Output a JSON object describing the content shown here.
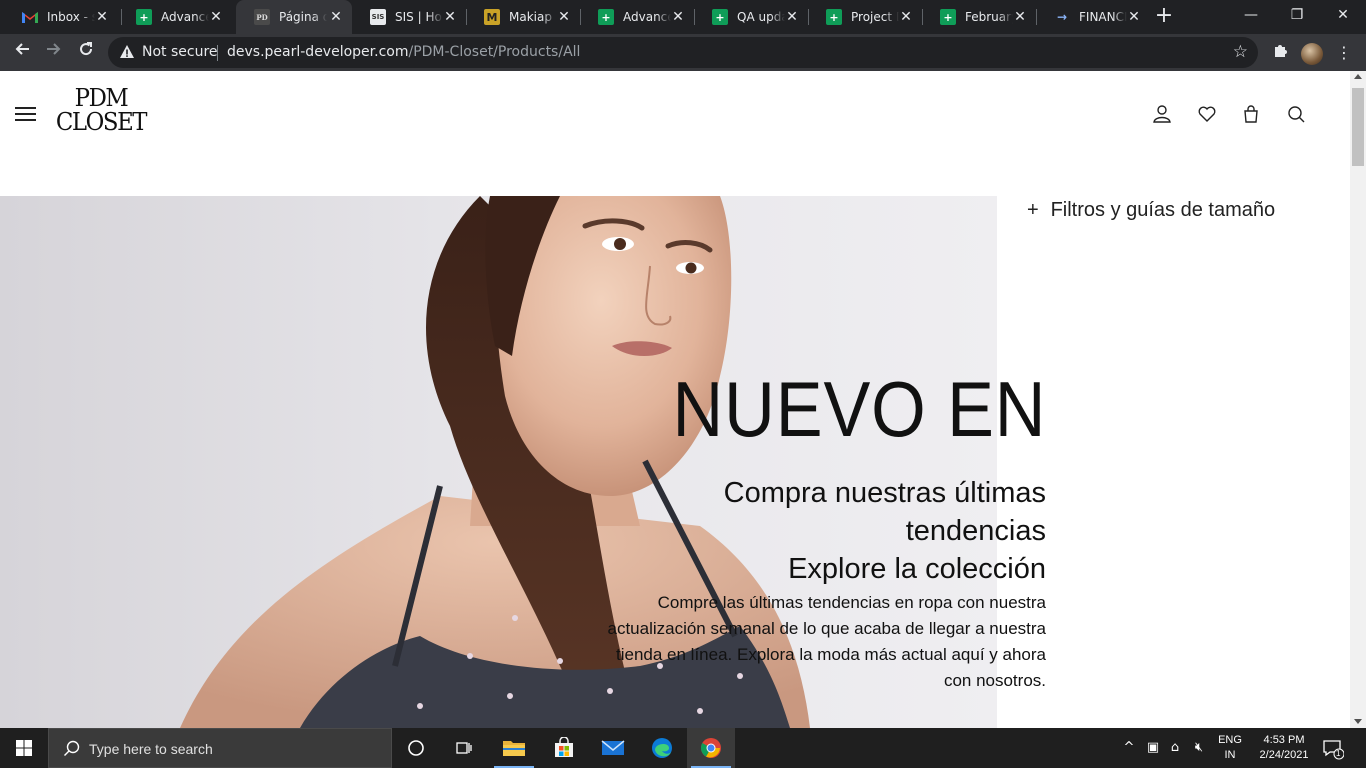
{
  "browser": {
    "tabs": [
      {
        "title": "Inbox - su",
        "icon": "gmail-icon"
      },
      {
        "title": "Advanced",
        "icon": "sheets-icon"
      },
      {
        "title": "Página de",
        "icon": "pdm-icon"
      },
      {
        "title": "SIS | Hom",
        "icon": "sis-icon"
      },
      {
        "title": "Makiap",
        "icon": "makiap-icon"
      },
      {
        "title": "Advanced",
        "icon": "sheets-icon"
      },
      {
        "title": "QA upda",
        "icon": "sheets-icon"
      },
      {
        "title": "Project D",
        "icon": "sheets-icon"
      },
      {
        "title": "February",
        "icon": "sheets-icon"
      },
      {
        "title": "FINANCIA",
        "icon": "arrow-icon"
      }
    ],
    "active_tab_index": 2,
    "security_label": "Not secure",
    "url_host": "devs.pearl-developer.com",
    "url_path": "/PDM-Closet/Products/All"
  },
  "site": {
    "logo_line1": "PDM",
    "logo_line2": "CLOSET",
    "filters_label": "Filtros y guías de tamaño"
  },
  "hero": {
    "title": "NUEVO EN",
    "subtitle_line1": "Compra nuestras últimas",
    "subtitle_line2": "tendencias",
    "subtitle_line3": "Explore la colección",
    "paragraph": "Compre las últimas tendencias en ropa con nuestra actualización semanal de lo que acaba de llegar a nuestra tienda en línea. Explora la moda más actual aquí y ahora con nosotros."
  },
  "taskbar": {
    "search_placeholder": "Type here to search",
    "lang_line1": "ENG",
    "lang_line2": "IN",
    "time": "4:53 PM",
    "date": "2/24/2021",
    "notification_count": "1"
  },
  "colors": {
    "tabstrip": "#202124",
    "toolbar": "#35363a",
    "taskbar": "#1f1f1f",
    "sheets_green": "#0f9d58"
  }
}
